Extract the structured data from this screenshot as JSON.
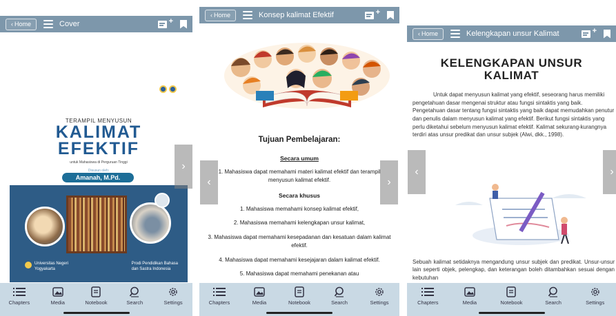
{
  "screens": [
    {
      "topbar": {
        "home_label": "Home",
        "title": "Cover"
      },
      "cover": {
        "kicker": "TERAMPIL MENYUSUN",
        "title_line1": "KALIMAT",
        "title_line2": "EFEKTIF",
        "subtitle": "untuk Mahasiswa di Perguruan Tinggi",
        "author_label": "Disusun oleh:",
        "author": "Amanah, M.Pd.",
        "university_line1": "Universitas Negeri",
        "university_line2": "Yogyakarta",
        "program_line1": "Prodi Pendidikan Bahasa",
        "program_line2": "dan Sastra Indonesia"
      }
    },
    {
      "topbar": {
        "home_label": "Home",
        "title": "Konsep kalimat Efektif"
      },
      "content": {
        "heading": "Tujuan Pembelajaran:",
        "general_heading": "Secara umum",
        "general_item": "1. Mahasiswa dapat memahami materi kalimat efektif dan terampil menyusun kalimat efektif.",
        "specific_heading": "Secara khusus",
        "specific_items": [
          "1. Mahasiswa memahami konsep kalimat efektif,",
          "2. Mahasiswa memahami kelengkapan unsur kalimat,",
          "3. Mahasiswa dapat memahami kesepadanan dan kesatuan dalam kalimat efektif.",
          "4. Mahasiswa dapat memahami kesejajaran dalam kalimat efektif.",
          "5. Mahasiswa dapat memahami penekanan atau"
        ]
      }
    },
    {
      "topbar": {
        "home_label": "Home",
        "title": "Kelengkapan unsur Kalimat"
      },
      "content": {
        "title_line1": "KELENGKAPAN UNSUR",
        "title_line2": "KALIMAT",
        "paragraph1": "Untuk dapat menyusun kalimat yang efektif, seseorang harus memiliki pengetahuan dasar mengenai struktur atau fungsi sintaktis yang baik. Pengetahuan dasar tentang fungsi sintaktis yang baik dapat memudahkan penutur dan penulis dalam menyusun kalimat yang efektif. Berikut fungsi sintaktis yang perlu diketahui sebelum menyusun kalimat efektif. Kalimat sekurang-kurangnya terdiri atas unsur predikat dan unsur subjek (Alwi, dkk., 1998).",
        "paragraph2": "Sebuah kalimat setidaknya mengandung unsur subjek dan predikat. Unsur-unsur lain seperti objek, pelengkap, dan keterangan boleh ditambahkan sesuai dengan kebutuhan"
      }
    }
  ],
  "bottom_nav": [
    "Chapters",
    "Media",
    "Notebook",
    "Search",
    "Settings"
  ],
  "colors": {
    "topbar": "#7d97ab",
    "bottombar": "#c9d9e4",
    "cover_title": "#215a92",
    "cover_band": "#2e5c86"
  }
}
